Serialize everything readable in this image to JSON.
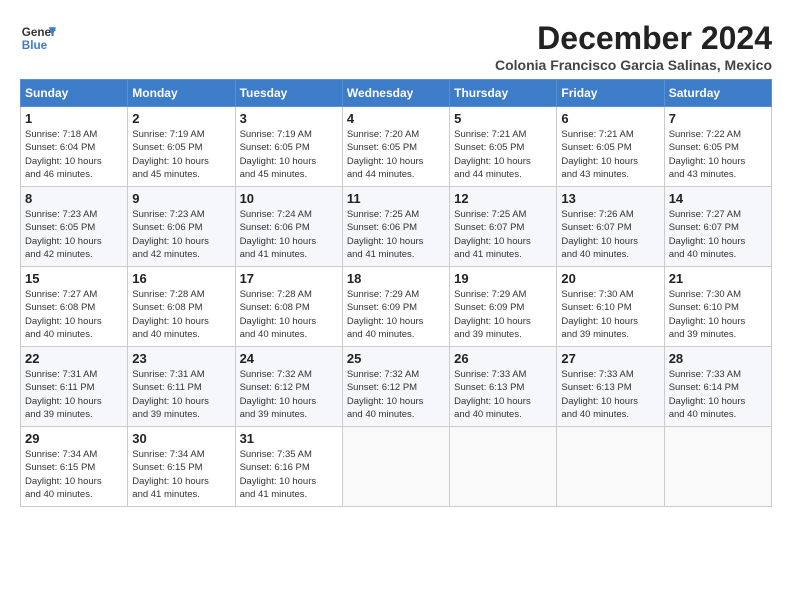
{
  "header": {
    "logo_line1": "General",
    "logo_line2": "Blue",
    "month_title": "December 2024",
    "location": "Colonia Francisco Garcia Salinas, Mexico"
  },
  "days_of_week": [
    "Sunday",
    "Monday",
    "Tuesday",
    "Wednesday",
    "Thursday",
    "Friday",
    "Saturday"
  ],
  "weeks": [
    [
      {
        "day": "1",
        "info": "Sunrise: 7:18 AM\nSunset: 6:04 PM\nDaylight: 10 hours\nand 46 minutes."
      },
      {
        "day": "2",
        "info": "Sunrise: 7:19 AM\nSunset: 6:05 PM\nDaylight: 10 hours\nand 45 minutes."
      },
      {
        "day": "3",
        "info": "Sunrise: 7:19 AM\nSunset: 6:05 PM\nDaylight: 10 hours\nand 45 minutes."
      },
      {
        "day": "4",
        "info": "Sunrise: 7:20 AM\nSunset: 6:05 PM\nDaylight: 10 hours\nand 44 minutes."
      },
      {
        "day": "5",
        "info": "Sunrise: 7:21 AM\nSunset: 6:05 PM\nDaylight: 10 hours\nand 44 minutes."
      },
      {
        "day": "6",
        "info": "Sunrise: 7:21 AM\nSunset: 6:05 PM\nDaylight: 10 hours\nand 43 minutes."
      },
      {
        "day": "7",
        "info": "Sunrise: 7:22 AM\nSunset: 6:05 PM\nDaylight: 10 hours\nand 43 minutes."
      }
    ],
    [
      {
        "day": "8",
        "info": "Sunrise: 7:23 AM\nSunset: 6:05 PM\nDaylight: 10 hours\nand 42 minutes."
      },
      {
        "day": "9",
        "info": "Sunrise: 7:23 AM\nSunset: 6:06 PM\nDaylight: 10 hours\nand 42 minutes."
      },
      {
        "day": "10",
        "info": "Sunrise: 7:24 AM\nSunset: 6:06 PM\nDaylight: 10 hours\nand 41 minutes."
      },
      {
        "day": "11",
        "info": "Sunrise: 7:25 AM\nSunset: 6:06 PM\nDaylight: 10 hours\nand 41 minutes."
      },
      {
        "day": "12",
        "info": "Sunrise: 7:25 AM\nSunset: 6:07 PM\nDaylight: 10 hours\nand 41 minutes."
      },
      {
        "day": "13",
        "info": "Sunrise: 7:26 AM\nSunset: 6:07 PM\nDaylight: 10 hours\nand 40 minutes."
      },
      {
        "day": "14",
        "info": "Sunrise: 7:27 AM\nSunset: 6:07 PM\nDaylight: 10 hours\nand 40 minutes."
      }
    ],
    [
      {
        "day": "15",
        "info": "Sunrise: 7:27 AM\nSunset: 6:08 PM\nDaylight: 10 hours\nand 40 minutes."
      },
      {
        "day": "16",
        "info": "Sunrise: 7:28 AM\nSunset: 6:08 PM\nDaylight: 10 hours\nand 40 minutes."
      },
      {
        "day": "17",
        "info": "Sunrise: 7:28 AM\nSunset: 6:08 PM\nDaylight: 10 hours\nand 40 minutes."
      },
      {
        "day": "18",
        "info": "Sunrise: 7:29 AM\nSunset: 6:09 PM\nDaylight: 10 hours\nand 40 minutes."
      },
      {
        "day": "19",
        "info": "Sunrise: 7:29 AM\nSunset: 6:09 PM\nDaylight: 10 hours\nand 39 minutes."
      },
      {
        "day": "20",
        "info": "Sunrise: 7:30 AM\nSunset: 6:10 PM\nDaylight: 10 hours\nand 39 minutes."
      },
      {
        "day": "21",
        "info": "Sunrise: 7:30 AM\nSunset: 6:10 PM\nDaylight: 10 hours\nand 39 minutes."
      }
    ],
    [
      {
        "day": "22",
        "info": "Sunrise: 7:31 AM\nSunset: 6:11 PM\nDaylight: 10 hours\nand 39 minutes."
      },
      {
        "day": "23",
        "info": "Sunrise: 7:31 AM\nSunset: 6:11 PM\nDaylight: 10 hours\nand 39 minutes."
      },
      {
        "day": "24",
        "info": "Sunrise: 7:32 AM\nSunset: 6:12 PM\nDaylight: 10 hours\nand 39 minutes."
      },
      {
        "day": "25",
        "info": "Sunrise: 7:32 AM\nSunset: 6:12 PM\nDaylight: 10 hours\nand 40 minutes."
      },
      {
        "day": "26",
        "info": "Sunrise: 7:33 AM\nSunset: 6:13 PM\nDaylight: 10 hours\nand 40 minutes."
      },
      {
        "day": "27",
        "info": "Sunrise: 7:33 AM\nSunset: 6:13 PM\nDaylight: 10 hours\nand 40 minutes."
      },
      {
        "day": "28",
        "info": "Sunrise: 7:33 AM\nSunset: 6:14 PM\nDaylight: 10 hours\nand 40 minutes."
      }
    ],
    [
      {
        "day": "29",
        "info": "Sunrise: 7:34 AM\nSunset: 6:15 PM\nDaylight: 10 hours\nand 40 minutes."
      },
      {
        "day": "30",
        "info": "Sunrise: 7:34 AM\nSunset: 6:15 PM\nDaylight: 10 hours\nand 41 minutes."
      },
      {
        "day": "31",
        "info": "Sunrise: 7:35 AM\nSunset: 6:16 PM\nDaylight: 10 hours\nand 41 minutes."
      },
      {
        "day": "",
        "info": ""
      },
      {
        "day": "",
        "info": ""
      },
      {
        "day": "",
        "info": ""
      },
      {
        "day": "",
        "info": ""
      }
    ]
  ]
}
